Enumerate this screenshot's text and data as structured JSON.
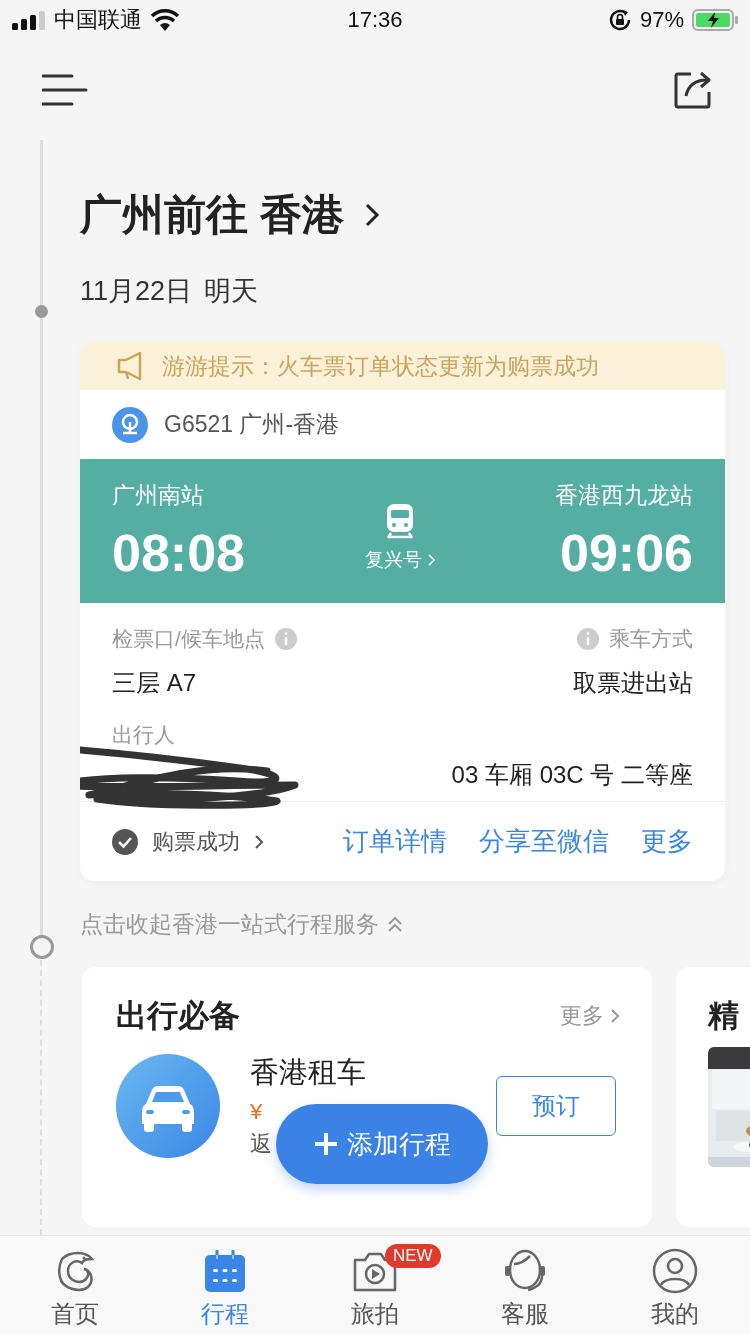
{
  "status_bar": {
    "carrier": "中国联通",
    "time": "17:36",
    "battery": "97%"
  },
  "title": "广州前往 香港",
  "date": {
    "day": "11月22日",
    "relative": "明天"
  },
  "trip_card": {
    "notice": "游游提示：火车票订单状态更新为购票成功",
    "train": "G6521 广州-香港",
    "departure": {
      "station": "广州南站",
      "time": "08:08"
    },
    "arrival": {
      "station": "香港西九龙站",
      "time": "09:06"
    },
    "train_type": "复兴号",
    "details": [
      {
        "label": "检票口/候车地点",
        "value": "三层 A7"
      },
      {
        "label": "乘车方式",
        "value": "取票进出站"
      }
    ],
    "passenger_label": "出行人",
    "seat": "03 车厢 03C 号 二等座",
    "status": "购票成功",
    "actions": [
      "订单详情",
      "分享至微信",
      "更多"
    ]
  },
  "collapse_text": "点击收起香港一站式行程服务",
  "services": {
    "title": "出行必备",
    "more": "更多",
    "item": {
      "name": "香港租车",
      "price": "¥",
      "note": "返",
      "button": "预订"
    }
  },
  "next_card": {
    "title": "精",
    "kind": "picture"
  },
  "fab": {
    "label": "添加行程"
  },
  "tabs": [
    {
      "label": "首页",
      "selected": false
    },
    {
      "label": "行程",
      "selected": true
    },
    {
      "label": "旅拍",
      "selected": false,
      "badge": "NEW"
    },
    {
      "label": "客服",
      "selected": false
    },
    {
      "label": "我的",
      "selected": false
    }
  ]
}
